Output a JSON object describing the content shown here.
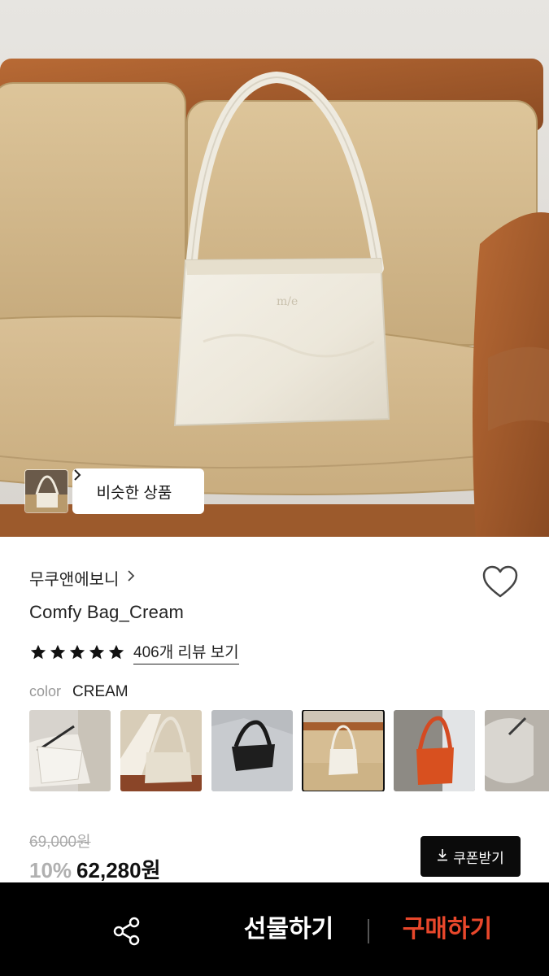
{
  "hero": {
    "image_name": "product-hero-image",
    "similar_label": "비슷한 상품"
  },
  "brand": {
    "name": "무쿠앤에보니"
  },
  "product": {
    "name": "Comfy Bag_Cream",
    "rating": 5,
    "review_link": "406개 리뷰 보기"
  },
  "option": {
    "label": "color",
    "value": "CREAM"
  },
  "variants": [
    {
      "name": "variant-white-worn",
      "selected": false
    },
    {
      "name": "variant-cream-beige",
      "selected": false
    },
    {
      "name": "variant-black",
      "selected": false
    },
    {
      "name": "variant-cream-sofa",
      "selected": true
    },
    {
      "name": "variant-orange",
      "selected": false
    },
    {
      "name": "variant-grey",
      "selected": false
    }
  ],
  "price": {
    "original": "69,000원",
    "discount": "10%",
    "current": "62,280원"
  },
  "coupon": {
    "label": "쿠폰받기"
  },
  "bottom_bar": {
    "gift_label": "선물하기",
    "buy_label": "구매하기"
  },
  "colors": {
    "accent_buy": "#e8472b",
    "bar_bg": "#000000",
    "star": "#111111"
  }
}
